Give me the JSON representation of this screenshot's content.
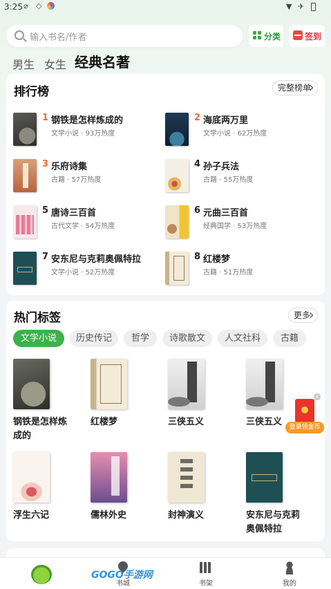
{
  "status_bar": {
    "time": "3:25"
  },
  "search": {
    "placeholder": "输入书名/作者"
  },
  "header_buttons": {
    "category": "分类",
    "signin": "签到"
  },
  "category_tabs": [
    {
      "label": "男生",
      "active": false
    },
    {
      "label": "女生",
      "active": false
    },
    {
      "label": "经典名著",
      "active": true
    }
  ],
  "ranking": {
    "title": "排行榜",
    "more": "完整榜单",
    "items": [
      {
        "rank": "1",
        "name": "钢铁是怎样炼成的",
        "meta": "文学小说 · 93万热度"
      },
      {
        "rank": "2",
        "name": "海底两万里",
        "meta": "文学小说 · 62万热度"
      },
      {
        "rank": "3",
        "name": "乐府诗集",
        "meta": "古籍 · 57万热度"
      },
      {
        "rank": "4",
        "name": "孙子兵法",
        "meta": "古籍 · 55万热度"
      },
      {
        "rank": "5",
        "name": "唐诗三百首",
        "meta": "古代文学 · 54万热度"
      },
      {
        "rank": "6",
        "name": "元曲三百首",
        "meta": "经典国学 · 53万热度"
      },
      {
        "rank": "7",
        "name": "安东尼与克莉奥佩特拉",
        "meta": "文学小说 · 52万热度"
      },
      {
        "rank": "8",
        "name": "红楼梦",
        "meta": "古籍 · 51万热度"
      }
    ]
  },
  "hot_tags": {
    "title": "热门标签",
    "more": "更多",
    "tags": [
      "文学小说",
      "历史传记",
      "哲学",
      "诗歌散文",
      "人文社科",
      "古籍"
    ],
    "active_tag": "文学小说",
    "books": [
      {
        "name": "钢铁是怎样炼成的"
      },
      {
        "name": "红楼梦"
      },
      {
        "name": "三侠五义"
      },
      {
        "name": "三侠五义"
      },
      {
        "name": "浮生六记"
      },
      {
        "name": "儒林外史"
      },
      {
        "name": "封神演义"
      },
      {
        "name": "安东尼与克莉奥佩特拉"
      }
    ]
  },
  "promo": {
    "label": "登录领金币"
  },
  "bottom_nav": [
    {
      "label": "",
      "icon": "app-mascot-icon"
    },
    {
      "label": "书城",
      "icon": "bookstore-icon"
    },
    {
      "label": "书架",
      "icon": "bookshelf-icon"
    },
    {
      "label": "我的",
      "icon": "profile-icon"
    }
  ],
  "watermark": "GOGO手游网",
  "colors": {
    "accent_green": "#3bb34a",
    "hot_orange": "#ec6b2d",
    "sign_red": "#e23b3b"
  }
}
